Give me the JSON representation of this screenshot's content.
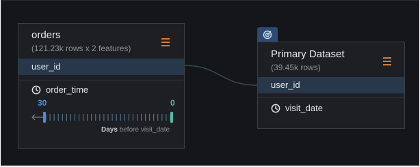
{
  "orders_node": {
    "title": "orders",
    "subtitle": "(121.23k rows x 2 features)",
    "key_field": "user_id",
    "feature": {
      "name": "order_time",
      "range_start": "30",
      "range_end": "0",
      "caption_bold": "Days",
      "caption_rest": " before visit_date"
    }
  },
  "primary_node": {
    "badge_icon": "target-icon",
    "title": "Primary Dataset",
    "subtitle": "(39.45k rows)",
    "key_field": "user_id",
    "feature": {
      "name": "visit_date"
    }
  },
  "colors": {
    "canvas_bg": "#151619",
    "node_bg": "#1d1f23",
    "key_row_bg": "#27384b",
    "menu_accent": "#e07a2a",
    "range_start_color": "#4a8ad8",
    "range_end_color": "#54b8a5",
    "connector": "#2f4d55"
  }
}
